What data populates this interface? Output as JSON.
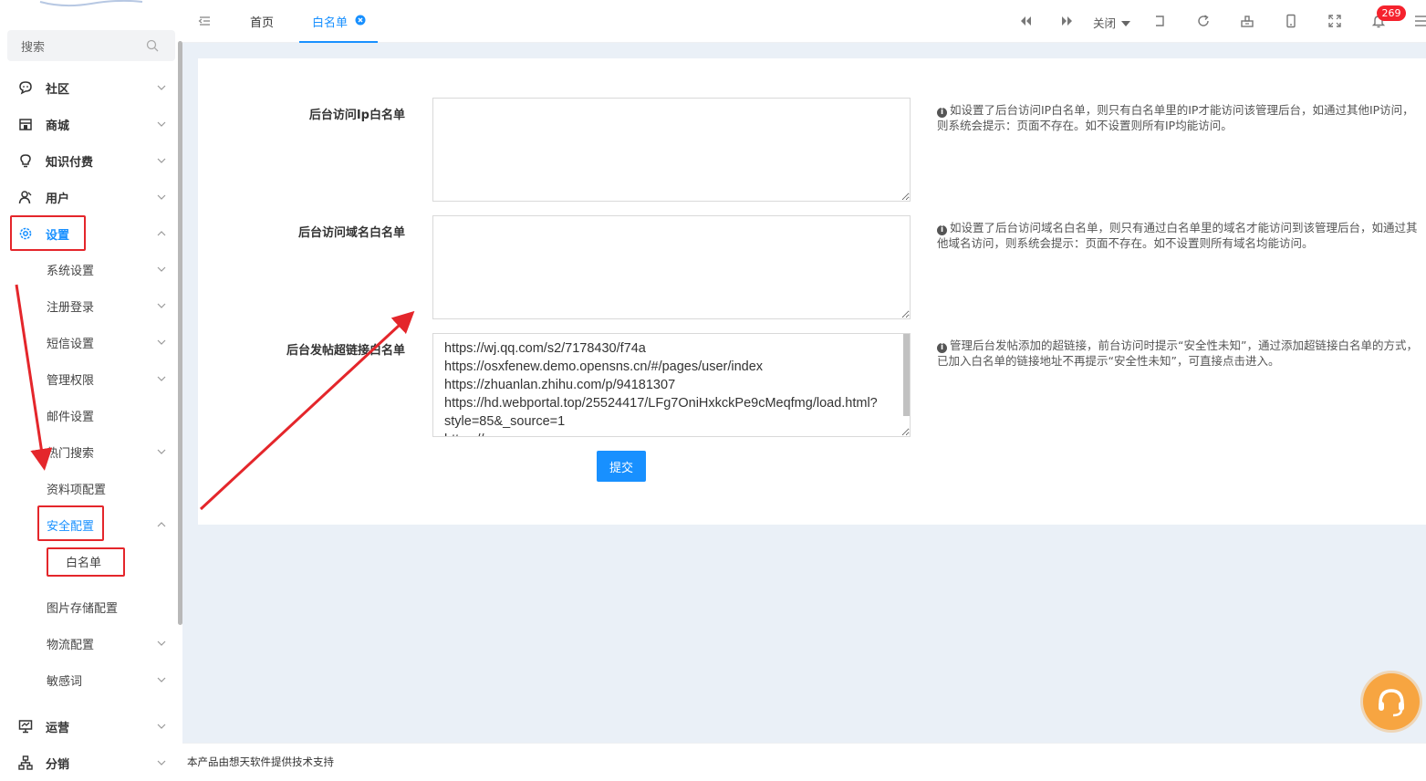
{
  "sidebar": {
    "search_placeholder": "搜索",
    "items": [
      {
        "label": "社区"
      },
      {
        "label": "商城"
      },
      {
        "label": "知识付费"
      },
      {
        "label": "用户"
      },
      {
        "label": "设置"
      },
      {
        "label": "运营"
      },
      {
        "label": "分销"
      }
    ],
    "settings_sub": [
      {
        "label": "系统设置"
      },
      {
        "label": "注册登录"
      },
      {
        "label": "短信设置"
      },
      {
        "label": "管理权限"
      },
      {
        "label": "邮件设置"
      },
      {
        "label": "热门搜索"
      },
      {
        "label": "资料项配置"
      },
      {
        "label": "安全配置"
      },
      {
        "label": "白名单"
      },
      {
        "label": "图片存储配置"
      },
      {
        "label": "物流配置"
      },
      {
        "label": "敏感词"
      }
    ]
  },
  "topbar": {
    "tabs": [
      {
        "label": "首页"
      },
      {
        "label": "白名单"
      }
    ],
    "close_label": "关闭",
    "notification_count": "269",
    "accent_color": "#1890ff"
  },
  "form": {
    "ip_label": "后台访问Ip白名单",
    "ip_value": "",
    "ip_hint": "如设置了后台访问IP白名单，则只有白名单里的IP才能访问该管理后台，如通过其他IP访问，则系统会提示：页面不存在。如不设置则所有IP均能访问。",
    "domain_label": "后台访问域名白名单",
    "domain_value": "",
    "domain_hint": "如设置了后台访问域名白名单，则只有通过白名单里的域名才能访问到该管理后台，如通过其他域名访问，则系统会提示：页面不存在。如不设置则所有域名均能访问。",
    "link_label": "后台发帖超链接白名单",
    "link_value": "https://wj.qq.com/s2/7178430/f74a\nhttps://osxfenew.demo.opensns.cn/#/pages/user/index\nhttps://zhuanlan.zhihu.com/p/94181307\nhttps://hd.webportal.top/25524417/LFg7OniHxkckPe9cMeqfmg/load.html?style=85&_source=1\nhttps://",
    "link_hint": "管理后台发帖添加的超链接，前台访问时提示“安全性未知”，通过添加超链接白名单的方式，已加入白名单的链接地址不再提示“安全性未知”，可直接点击进入。",
    "submit_label": "提交"
  },
  "footer": {
    "text": "本产品由想天软件提供技术支持"
  },
  "colors": {
    "annotation_red": "#e4262b",
    "chat_orange": "#f7a541"
  }
}
